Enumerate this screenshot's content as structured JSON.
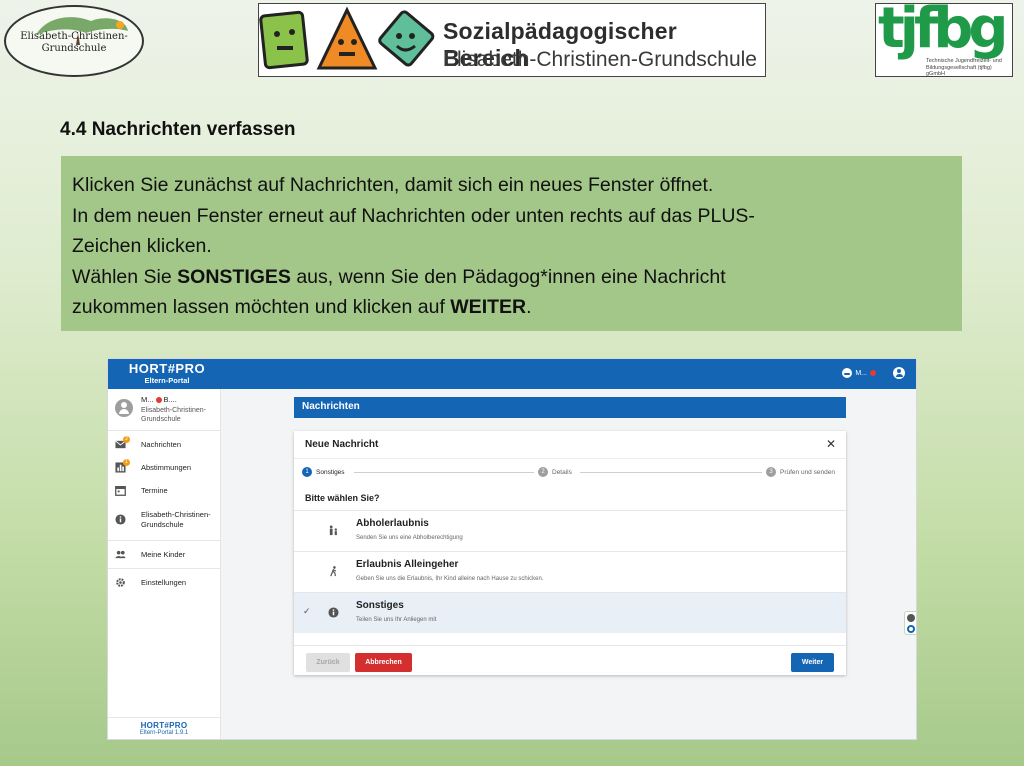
{
  "logos": {
    "left_line1": "Elisabeth-Christinen-",
    "left_line2": "Grundschule",
    "center_title": "Sozialpädagogischer Bereich",
    "center_subtitle": "Elisabeth-Christinen-Grundschule",
    "right_mark": "tjfbg",
    "right_subtitle": "Technische Jugendfreizeit- und Bildungsgesellschaft (tjfbg) gGmbH"
  },
  "slide": {
    "heading": "4.4 Nachrichten verfassen",
    "line1": "Klicken Sie zunächst auf Nachrichten, damit sich ein neues Fenster öffnet.",
    "line2": "In dem neuen Fenster erneut auf Nachrichten oder unten rechts auf das PLUS-",
    "line3": "Zeichen klicken.",
    "line4_a": "Wählen Sie ",
    "line4_b": "SONSTIGES",
    "line4_c": " aus, wenn Sie den Pädagog*innen eine Nachricht",
    "line5_a": "zukommen lassen möchten und klicken auf ",
    "line5_b": "WEITER",
    "line5_c": "."
  },
  "app": {
    "brand_name": "HORT#PRO",
    "brand_sub": "Eltern-Portal",
    "top_user": "M...",
    "profile": {
      "name": "M...",
      "name2": "B....",
      "school": "Elisabeth-Christinen-Grundschule"
    },
    "nav": [
      {
        "label": "Nachrichten",
        "icon": "mail-icon",
        "badge": "2"
      },
      {
        "label": "Abstimmungen",
        "icon": "poll-icon",
        "badge": "1"
      },
      {
        "label": "Termine",
        "icon": "calendar-icon"
      },
      {
        "label": "Elisabeth-Christinen-Grundschule",
        "icon": "info-icon"
      },
      {
        "label": "Meine Kinder",
        "icon": "group-icon"
      },
      {
        "label": "Einstellungen",
        "icon": "gear-icon"
      }
    ],
    "footer_name": "HORT#PRO",
    "footer_version": "Eltern-Portal 1.9.1",
    "page_title": "Nachrichten",
    "dialog": {
      "title": "Neue Nachricht",
      "close": "✕",
      "steps": [
        {
          "num": "1",
          "label": "Sonstiges"
        },
        {
          "num": "2",
          "label": "Details"
        },
        {
          "num": "3",
          "label": "Prüfen und senden"
        }
      ],
      "question": "Bitte wählen Sie?",
      "options": [
        {
          "title": "Abholerlaubnis",
          "sub": "Senden Sie uns eine Abholberechtigung",
          "icon": "family-icon"
        },
        {
          "title": "Erlaubnis Alleingeher",
          "sub": "Geben Sie uns die Erlaubnis, Ihr Kind alleine nach Hause zu schicken.",
          "icon": "walking-icon"
        },
        {
          "title": "Sonstiges",
          "sub": "Teilen Sie uns Ihr Anliegen mit",
          "icon": "info-icon"
        }
      ],
      "btn_back": "Zurück",
      "btn_cancel": "Abbrechen",
      "btn_next": "Weiter"
    }
  },
  "colors": {
    "primary": "#1565b5",
    "cancel": "#d32f2f",
    "instruction_box": "#a3c689"
  }
}
